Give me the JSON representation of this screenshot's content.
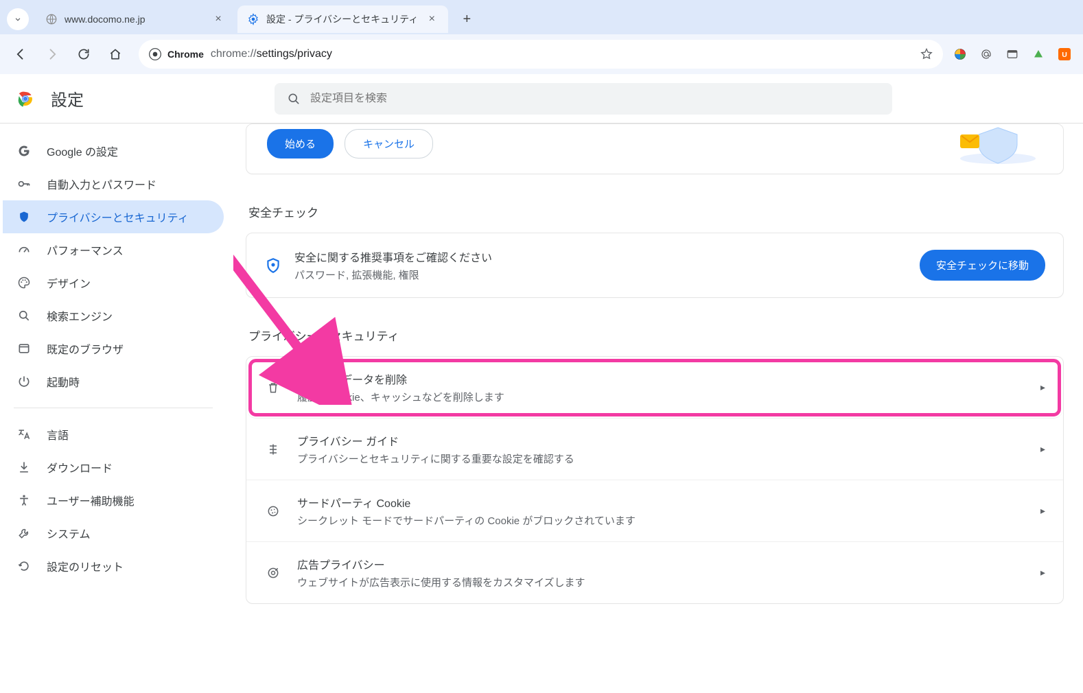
{
  "tabs": {
    "tab1_title": "www.docomo.ne.jp",
    "tab2_title": "設定 - プライバシーとセキュリティ"
  },
  "toolbar": {
    "chrome_label": "Chrome",
    "url_scheme": "chrome://",
    "url_path": "settings/privacy"
  },
  "header": {
    "title": "設定",
    "search_placeholder": "設定項目を検索"
  },
  "sidebar": {
    "google": "Google の設定",
    "autofill": "自動入力とパスワード",
    "privacy": "プライバシーとセキュリティ",
    "performance": "パフォーマンス",
    "design": "デザイン",
    "search_engine": "検索エンジン",
    "default_browser": "既定のブラウザ",
    "on_startup": "起動時",
    "language": "言語",
    "downloads": "ダウンロード",
    "accessibility": "ユーザー補助機能",
    "system": "システム",
    "reset": "設定のリセット"
  },
  "promo": {
    "start": "始める",
    "cancel": "キャンセル"
  },
  "safety_section_title": "安全チェック",
  "safety": {
    "line1": "安全に関する推奨事項をご確認ください",
    "line2": "パスワード, 拡張機能, 権限",
    "button": "安全チェックに移動"
  },
  "privacy_section_title": "プライバシーとセキュリティ",
  "rows": {
    "clear": {
      "title": "閲覧履歴データを削除",
      "sub": "履歴、Cookie、キャッシュなどを削除します"
    },
    "guide": {
      "title": "プライバシー ガイド",
      "sub": "プライバシーとセキュリティに関する重要な設定を確認する"
    },
    "third": {
      "title": "サードパーティ Cookie",
      "sub": "シークレット モードでサードパーティの Cookie がブロックされています"
    },
    "ads": {
      "title": "広告プライバシー",
      "sub": "ウェブサイトが広告表示に使用する情報をカスタマイズします"
    }
  },
  "annotation": {
    "color": "#f33aa3"
  }
}
